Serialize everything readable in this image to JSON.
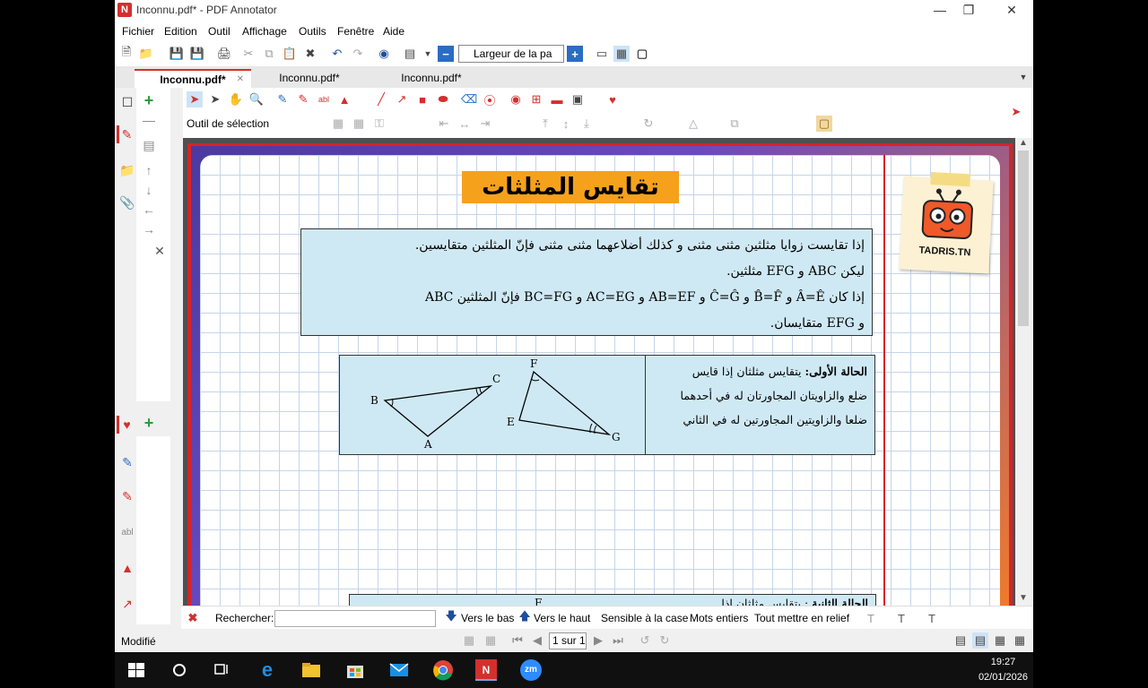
{
  "window": {
    "title": "Inconnu.pdf* - PDF Annotator"
  },
  "menu": [
    "Fichier",
    "Edition",
    "Outil",
    "Affichage",
    "Outils",
    "Fenêtre",
    "Aide"
  ],
  "toolbar": {
    "zoom_value": "Largeur de la pa"
  },
  "tabs": [
    {
      "label": "Inconnu.pdf*",
      "active": true
    },
    {
      "label": "Inconnu.pdf*",
      "active": false
    },
    {
      "label": "Inconnu.pdf*",
      "active": false
    }
  ],
  "tool_status": "Outil de sélection",
  "document": {
    "title": "تقايس المثلثات",
    "definition": [
      "إذا تقايست زوايا مثلثين مثنى مثنى و كذلك أضلاعهما مثنى مثنى فإنّ المثلثين متقايسين.",
      "ليكن ABC و EFG مثلثين.",
      "إذا كان Â=Ê و B̂=F̂ و Ĉ=Ĝ و AB=EF و AC=EG و BC=FG فإنّ المثلثين ABC",
      "و EFG متقايسان."
    ],
    "case1": {
      "heading": "الحالة الأولى:",
      "lines": [
        "يتقايس مثلثان إذا قايس",
        "ضلع والزاويتان المجاورتان له في أحدهما",
        "ضلعا والزاويتين المجاورتين له في الثاني"
      ]
    },
    "case2": {
      "heading": "الحالة الثانية",
      "text": ": يتقايس مثلثان إذا",
      "label": "F"
    },
    "labels": {
      "A": "A",
      "B": "B",
      "C": "C",
      "E": "E",
      "F": "F",
      "G": "G"
    },
    "logo": "TADRIS.TN"
  },
  "search": {
    "label": "Rechercher:",
    "value": "",
    "down": "Vers le bas",
    "up": "Vers le haut",
    "case_sensitive": "Sensible à la case",
    "whole_words": "Mots entiers",
    "highlight_all": "Tout mettre en relief"
  },
  "status": {
    "state": "Modifié",
    "page": "1 sur 1"
  },
  "taskbar": {
    "time": "19:27",
    "date": "02/01/2026"
  }
}
